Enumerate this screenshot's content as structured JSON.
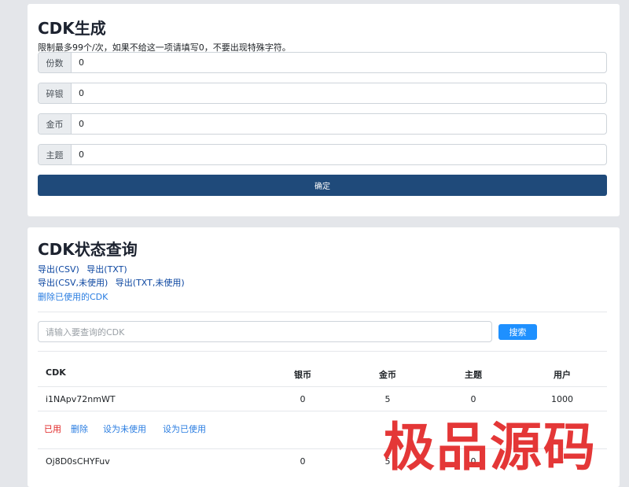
{
  "generator": {
    "title": "CDK生成",
    "note": "限制最多99个/次，如果不给这一项请填写0，不要出现特殊字符。",
    "fields": [
      {
        "label": "份数",
        "value": "0"
      },
      {
        "label": "碎银",
        "value": "0"
      },
      {
        "label": "金币",
        "value": "0"
      },
      {
        "label": "主题",
        "value": "0"
      }
    ],
    "submit_label": "确定"
  },
  "query": {
    "title": "CDK状态查询",
    "export_csv": "导出(CSV)",
    "export_txt": "导出(TXT)",
    "export_csv_unused": "导出(CSV,未使用)",
    "export_txt_unused": "导出(TXT,未使用)",
    "delete_used": "删除已使用的CDK",
    "search_placeholder": "请输入要查询的CDK",
    "search_label": "搜索",
    "columns": [
      "CDK",
      "银币",
      "金币",
      "主题",
      "用户"
    ],
    "rows": [
      {
        "cdk": "i1NApv72nmWT",
        "silver": "0",
        "gold": "5",
        "theme": "0",
        "user": "1000"
      },
      {
        "cdk": "Oj8D0sCHYFuv",
        "silver": "0",
        "gold": "5",
        "theme": "0",
        "user": "-"
      }
    ],
    "row_actions": {
      "status": "已用",
      "delete": "删除",
      "set_unused": "设为未使用",
      "set_used": "设为已使用"
    }
  },
  "watermark": "极品源码"
}
